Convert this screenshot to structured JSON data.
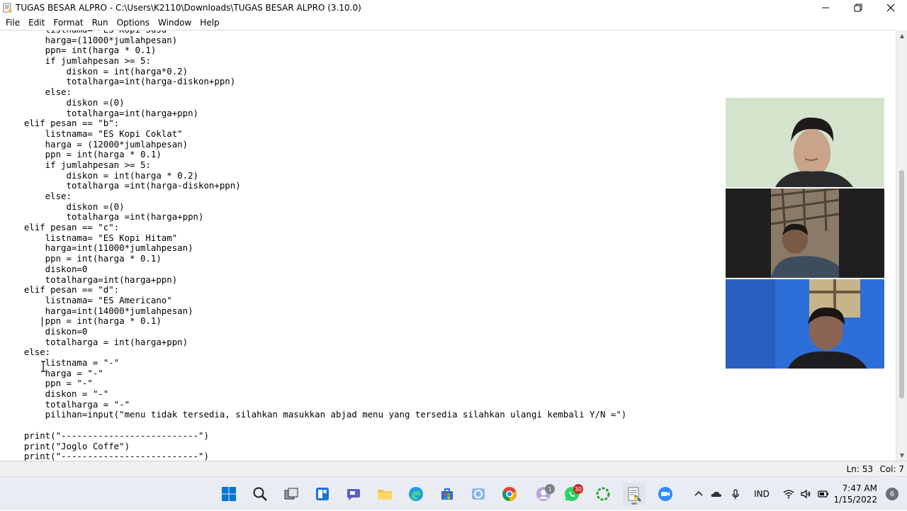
{
  "window": {
    "title": "TUGAS BESAR ALPRO - C:\\Users\\K2110\\Downloads\\TUGAS BESAR ALPRO (3.10.0)",
    "minimize": "—",
    "maximize": "❐",
    "close": "✕"
  },
  "menu": {
    "items": [
      "File",
      "Edit",
      "Format",
      "Run",
      "Options",
      "Window",
      "Help"
    ]
  },
  "editor": {
    "lines": [
      "        listnama= \"ES Kopi Susu\"",
      "        harga=(11000*jumlahpesan)",
      "        ppn= int(harga * 0.1)",
      "        if jumlahpesan >= 5:",
      "            diskon = int(harga*0.2)",
      "            totalharga=int(harga-diskon+ppn)",
      "        else:",
      "            diskon =(0)",
      "            totalharga=int(harga+ppn)",
      "    elif pesan == \"b\":",
      "        listnama= \"ES Kopi Coklat\"",
      "        harga = (12000*jumlahpesan)",
      "        ppn = int(harga * 0.1)",
      "        if jumlahpesan >= 5:",
      "            diskon = int(harga * 0.2)",
      "            totalharga =int(harga-diskon+ppn)",
      "        else:",
      "            diskon =(0)",
      "            totalharga =int(harga+ppn)",
      "    elif pesan == \"c\":",
      "        listnama= \"ES Kopi Hitam\"",
      "        harga=int(11000*jumlahpesan)",
      "        ppn = int(harga * 0.1)",
      "        diskon=0",
      "        totalharga=int(harga+ppn)",
      "    elif pesan == \"d\":",
      "        listnama= \"ES Americano\"",
      "        harga=int(14000*jumlahpesan)",
      "        ppn = int(harga * 0.1)",
      "        diskon=0",
      "        totalharga = int(harga+ppn)",
      "    else:",
      "        listnama = \"-\"",
      "        harga = \"-\"",
      "        ppn = \"-\"",
      "        diskon = \"-\"",
      "        totalharga = \"-\"",
      "        pilihan=input(\"menu tidak tersedia, silahkan masukkan abjad menu yang tersedia silahkan ulangi kembali Y/N =\")",
      "",
      "    print(\"--------------------------\")",
      "    print(\"Joglo Coffe\")",
      "    print(\"--------------------------\")"
    ]
  },
  "status": {
    "line": "Ln: 53",
    "col": "Col: 7"
  },
  "taskbar": {
    "lang": "IND",
    "time": "7:47 AM",
    "date": "1/15/2022",
    "notifications": "6",
    "whatsapp_badge": "30",
    "app_badge": "1"
  },
  "colors": {
    "taskbar_bg": "#e9edf3",
    "windows_blue": "#0078d4",
    "status_bg": "#f0f0f0"
  }
}
